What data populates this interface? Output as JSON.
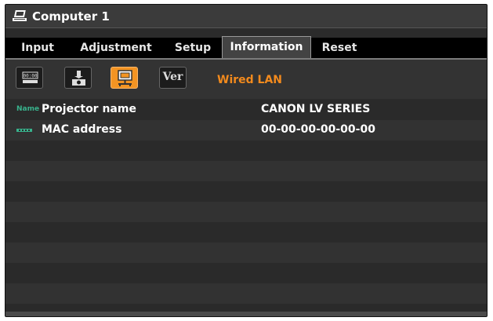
{
  "window": {
    "title": "Computer 1"
  },
  "tabs": [
    {
      "label": "Input",
      "active": false
    },
    {
      "label": "Adjustment",
      "active": false
    },
    {
      "label": "Setup",
      "active": false
    },
    {
      "label": "Information",
      "active": true
    },
    {
      "label": "Reset",
      "active": false
    }
  ],
  "toolbar": {
    "buttons": [
      {
        "icon": "clock-icon",
        "label": "",
        "selected": false
      },
      {
        "icon": "projector-lamp-icon",
        "label": "",
        "selected": false
      },
      {
        "icon": "wired-lan-icon",
        "label": "",
        "selected": true
      },
      {
        "icon": "version-icon",
        "label": "Ver",
        "selected": false
      }
    ],
    "section_label": "Wired LAN"
  },
  "info": {
    "rows": [
      {
        "icon_text": "Name",
        "label": "Projector name",
        "value": "CANON LV SERIES"
      },
      {
        "icon": "mac-address-icon",
        "label": "MAC address",
        "value": "00-00-00-00-00-00"
      }
    ]
  },
  "colors": {
    "accent": "#f39423",
    "label_accent": "#f28a1d",
    "icon_green": "#38b28c"
  }
}
